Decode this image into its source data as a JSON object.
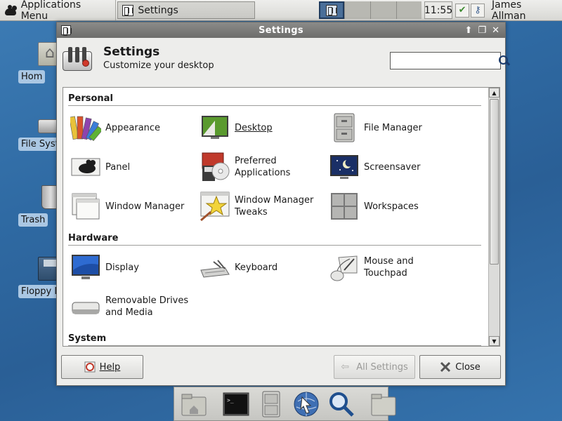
{
  "top_panel": {
    "app_menu_label": "Applications Menu",
    "task_label": "Settings",
    "clock": "11:55",
    "user": "James Allman"
  },
  "desktop": {
    "icons": [
      {
        "label": "Hom",
        "icon": "home-folder-icon"
      },
      {
        "label": "File Syst",
        "icon": "drive-icon"
      },
      {
        "label": "Trash",
        "icon": "trash-icon"
      },
      {
        "label": "Floppy D",
        "icon": "floppy-icon"
      }
    ]
  },
  "window": {
    "title": "Settings",
    "header_title": "Settings",
    "header_subtitle": "Customize your desktop",
    "search_value": "",
    "sections": {
      "personal": "Personal",
      "hardware": "Hardware",
      "system": "System"
    },
    "personal_items": [
      {
        "label": "Appearance",
        "icon": "appearance-icon"
      },
      {
        "label": "Desktop",
        "icon": "desktop-icon"
      },
      {
        "label": "File Manager",
        "icon": "file-manager-icon"
      },
      {
        "label": "Panel",
        "icon": "panel-icon"
      },
      {
        "label": "Preferred\nApplications",
        "icon": "preferred-applications-icon"
      },
      {
        "label": "Screensaver",
        "icon": "screensaver-icon"
      },
      {
        "label": "Window Manager",
        "icon": "window-manager-icon"
      },
      {
        "label": "Window Manager\nTweaks",
        "icon": "window-manager-tweaks-icon"
      },
      {
        "label": "Workspaces",
        "icon": "workspaces-icon"
      }
    ],
    "hardware_items": [
      {
        "label": "Display",
        "icon": "display-icon"
      },
      {
        "label": "Keyboard",
        "icon": "keyboard-icon"
      },
      {
        "label": "Mouse and\nTouchpad",
        "icon": "mouse-icon"
      },
      {
        "label": "Removable Drives\nand Media",
        "icon": "removable-drive-icon"
      }
    ],
    "buttons": {
      "help": "Help",
      "all_settings": "All Settings",
      "close": "Close"
    }
  },
  "dock": {
    "items": [
      "home-folder-icon",
      "terminal-icon",
      "file-manager-icon",
      "web-browser-icon",
      "search-icon",
      "folder-icon"
    ]
  },
  "colors": {
    "desktop_bg": "#2f6aa3",
    "titlebar": "#7a7a78",
    "label_bg": "#aac7e3"
  }
}
